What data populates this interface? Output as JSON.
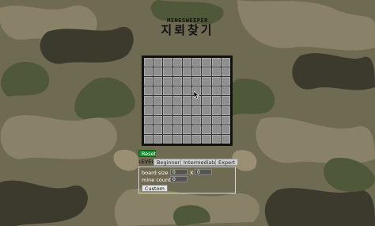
{
  "title": {
    "english": "MINESWEEPER",
    "korean": "지뢰찾기"
  },
  "board": {
    "rows": 9,
    "cols": 9
  },
  "controls": {
    "reset_label": "Reset",
    "level_label": "LEVEL",
    "levels": [
      "Beginner",
      "Intermediate",
      "Expert"
    ]
  },
  "custom": {
    "board_size_label": "board size :",
    "board_size_rows": "0",
    "size_separator": "X",
    "board_size_cols": "0",
    "mine_count_label": "mine count :",
    "mine_count": "0",
    "custom_label": "Custom"
  },
  "colors": {
    "accent_green": "#1a8a2a",
    "cell": "#8f8f8f",
    "board_frame": "#111111"
  },
  "icons": [
    "mouse-pointer-icon"
  ]
}
